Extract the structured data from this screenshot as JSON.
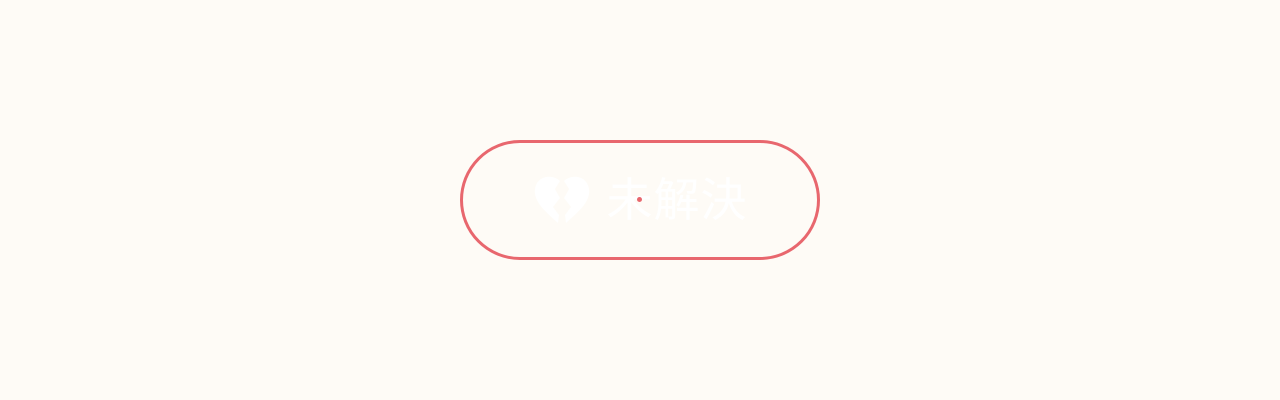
{
  "button": {
    "label": "未解決",
    "icon": "broken-heart-icon"
  },
  "colors": {
    "background": "#fefbf6",
    "accent": "#e8676e",
    "text": "#ffffff"
  }
}
